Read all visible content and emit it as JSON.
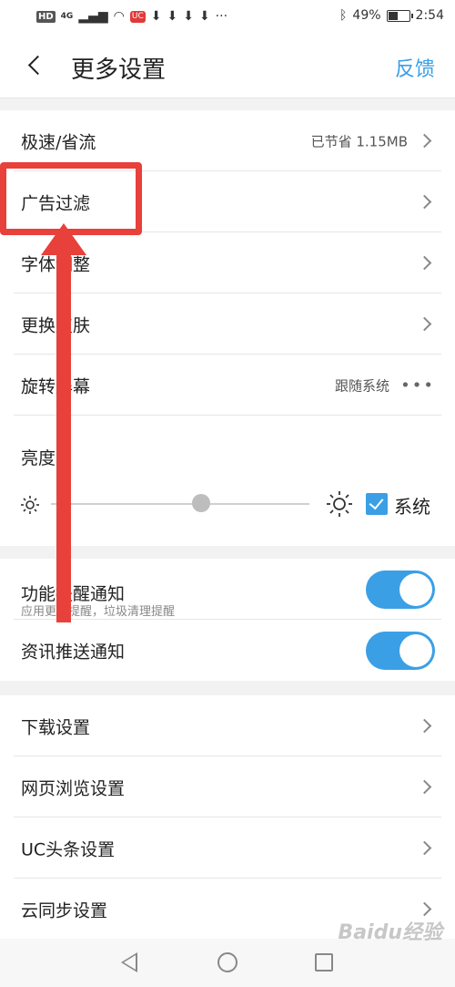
{
  "status_bar": {
    "network": "4G",
    "badge": "UC",
    "battery": "49%",
    "time": "2:54",
    "battery_level": 0.49
  },
  "header": {
    "title": "更多设置",
    "feedback": "反馈"
  },
  "group1": {
    "rows": [
      {
        "label": "极速/省流",
        "value": "已节省 1.15MB"
      },
      {
        "label": "广告过滤"
      },
      {
        "label": "字体调整"
      },
      {
        "label": "更换皮肤"
      },
      {
        "label": "旋转屏幕",
        "value": "跟随系统"
      }
    ],
    "brightness": {
      "label": "亮度",
      "level": 0.58,
      "system_label": "系统",
      "system_checked": true
    }
  },
  "group2": {
    "rows": [
      {
        "label": "功能提醒通知",
        "sub": "应用更新提醒，垃圾清理提醒",
        "enabled": true
      },
      {
        "label": "资讯推送通知",
        "enabled": true
      }
    ]
  },
  "group3": {
    "rows": [
      {
        "label": "下载设置"
      },
      {
        "label": "网页浏览设置"
      },
      {
        "label": "UC头条设置"
      },
      {
        "label": "云同步设置"
      }
    ]
  },
  "watermark": "Baidu经验",
  "colors": {
    "accent": "#3b9fe6",
    "annotation": "#e8403a"
  }
}
